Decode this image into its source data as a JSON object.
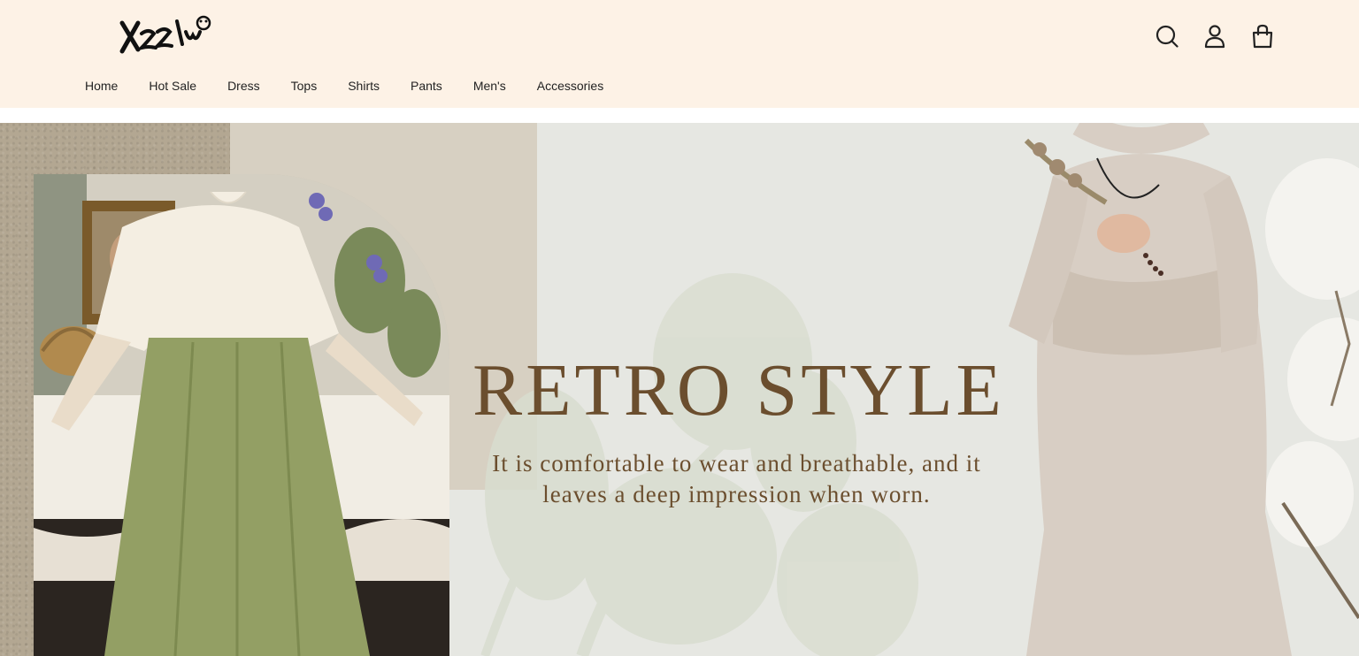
{
  "brand": {
    "logo_text": "Xzz/w"
  },
  "nav": {
    "items": [
      {
        "label": "Home"
      },
      {
        "label": "Hot Sale"
      },
      {
        "label": "Dress"
      },
      {
        "label": "Tops"
      },
      {
        "label": "Shirts"
      },
      {
        "label": "Pants"
      },
      {
        "label": "Men's"
      },
      {
        "label": "Accessories"
      }
    ]
  },
  "header_icons": [
    "search-icon",
    "account-icon",
    "shopping-bag-icon"
  ],
  "hero": {
    "title": "RETRO STYLE",
    "subtitle": "It is comfortable to wear and breathable, and it leaves a deep impression when worn."
  },
  "colors": {
    "header_bg": "#fdf2e6",
    "hero_bg": "#e6e7e2",
    "accent_text": "#6b4e2e"
  }
}
